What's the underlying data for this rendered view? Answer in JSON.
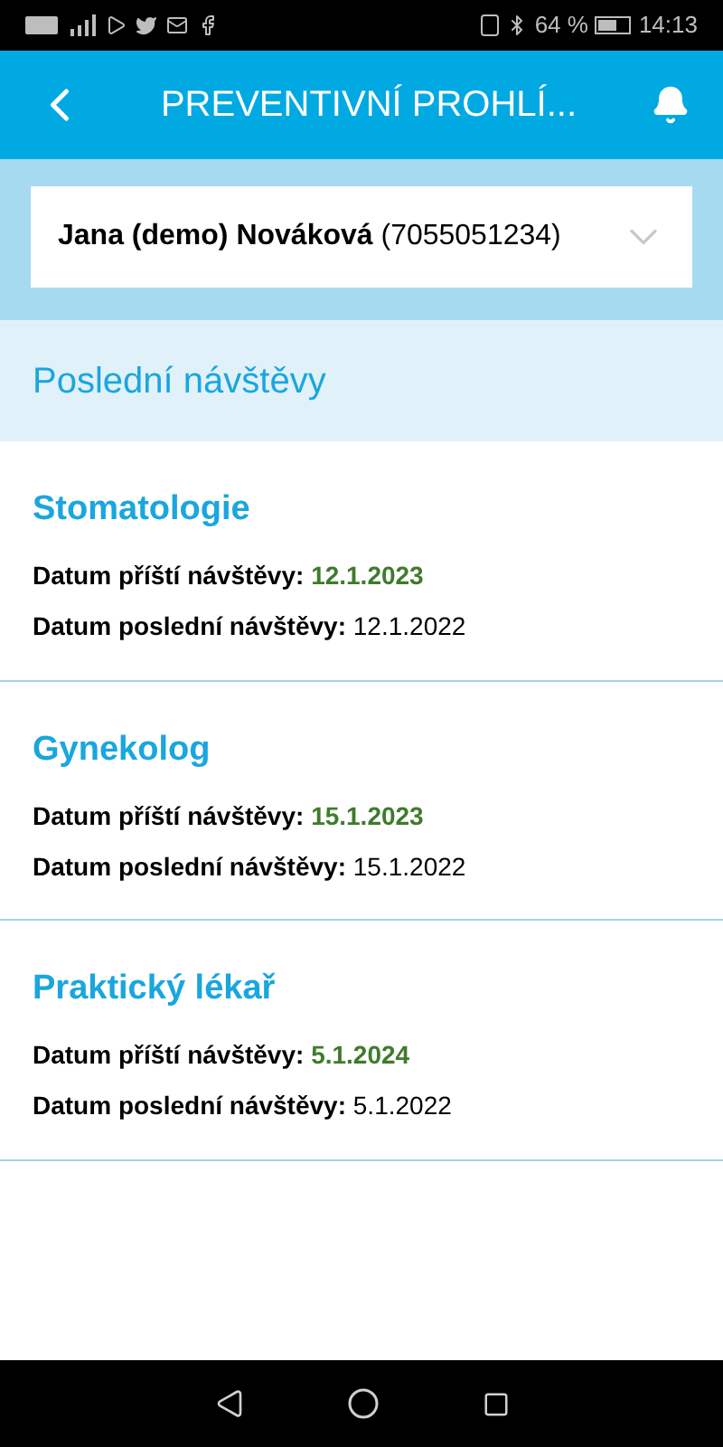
{
  "status_bar": {
    "battery_text": "64 %",
    "time": "14:13"
  },
  "header": {
    "title": "PREVENTIVNÍ PROHLÍ..."
  },
  "patient_select": {
    "name": "Jana (demo) Nováková",
    "id_text": "(7055051234)"
  },
  "section": {
    "title": "Poslední návštěvy"
  },
  "visits": [
    {
      "title": "Stomatologie",
      "rows": [
        {
          "kind": "next",
          "label": "Datum příští návštěvy:",
          "value": "12.1.2023"
        },
        {
          "kind": "last",
          "label": "Datum poslední návštěvy:",
          "value": "12.1.2022"
        }
      ]
    },
    {
      "title": "Gynekolog",
      "rows": [
        {
          "kind": "next",
          "label": "Datum příští návštěvy:",
          "value": "15.1.2023"
        },
        {
          "kind": "last",
          "label": "Datum poslední návštěvy:",
          "value": "15.1.2022"
        }
      ]
    },
    {
      "title": "Praktický lékař",
      "rows": [
        {
          "kind": "next",
          "label": "Datum příští návštěvy:",
          "value": "5.1.2024"
        },
        {
          "kind": "last",
          "label": "Datum poslední návštěvy:",
          "value": "5.1.2022"
        }
      ]
    }
  ]
}
